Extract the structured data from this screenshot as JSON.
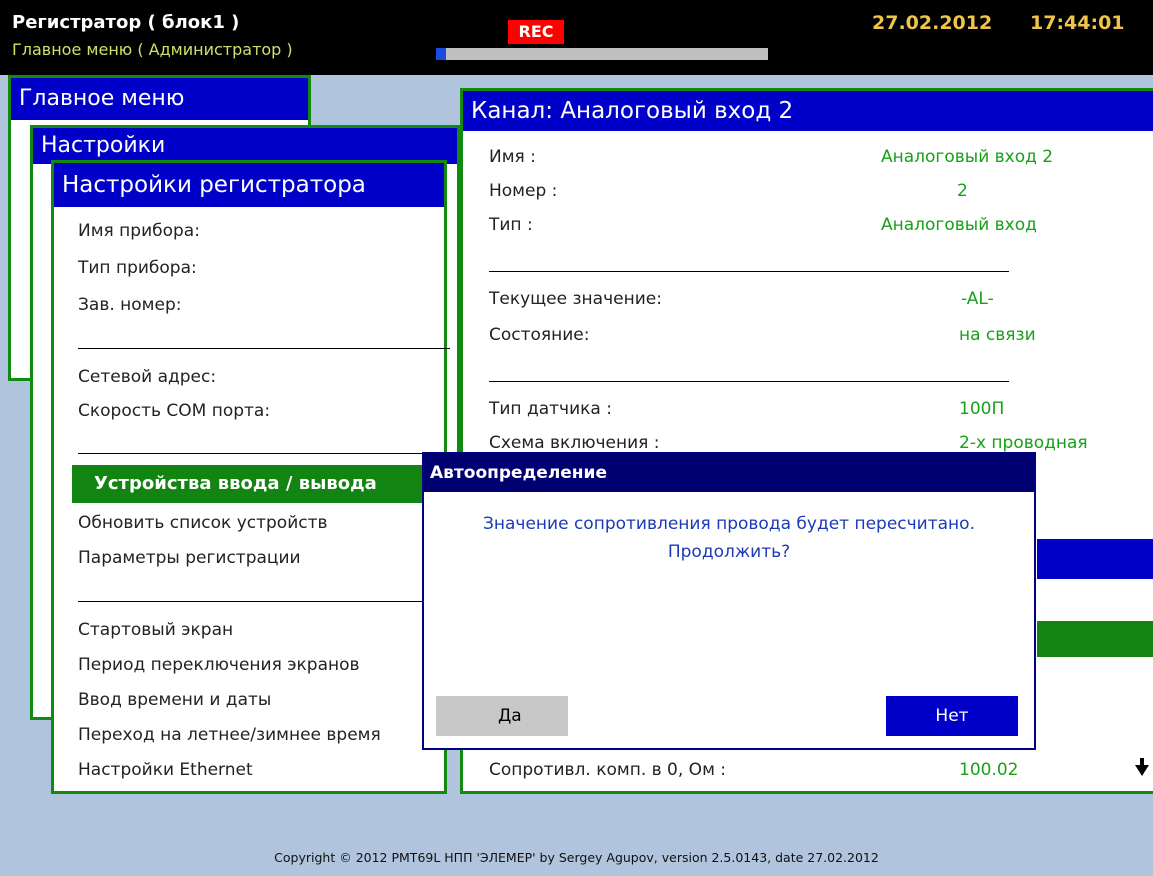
{
  "topbar": {
    "title": "Регистратор ( блок1 )",
    "subtitle": "Главное меню ( Администратор )",
    "rec_label": "REC",
    "date": "27.02.2012",
    "time": "17:44:01",
    "progress_fraction": 0.03
  },
  "panels": {
    "main_menu_title": "Главное меню",
    "settings_title": "Настройки",
    "recorder_settings": {
      "title": "Настройки регистратора",
      "items": [
        "Имя прибора:",
        "Тип прибора:",
        "Зав. номер:",
        "Сетевой адрес:",
        "Скорость COM порта:",
        "Устройства ввода / вывода",
        "Обновить список устройств",
        "Параметры регистрации",
        "Стартовый экран",
        "Период переключения экранов",
        "Ввод времени и даты",
        "Переход на летнее/зимнее время",
        "Настройки Ethernet"
      ]
    },
    "channel": {
      "title": "Канал: Аналоговый вход 2",
      "rows": [
        {
          "label": "Имя :",
          "value": "Аналоговый вход 2"
        },
        {
          "label": "Номер :",
          "value": "2"
        },
        {
          "label": "Тип :",
          "value": "Аналоговый вход"
        },
        {
          "label": "Текущее значение:",
          "value": "-AL-"
        },
        {
          "label": "Состояние:",
          "value": "на связи"
        },
        {
          "label": "Тип датчика :",
          "value": "100П"
        },
        {
          "label": "Схема включения :",
          "value": "2-х проводная"
        },
        {
          "label": "Сопротивл. комп. в 0, Ом :",
          "value": "100.02"
        }
      ]
    }
  },
  "dialog": {
    "title": "Автоопределение",
    "message_line1": "Значение сопротивления провода будет пересчитано.",
    "message_line2": "Продолжить?",
    "yes_label": "Да",
    "no_label": "Нет"
  },
  "footer": {
    "copyright": "Copyright © 2012 PMT69L НПП 'ЭЛЕМЕР' by Sergey Agupov, version 2.5.0143, date 27.02.2012"
  },
  "colors": {
    "header_blue": "#0000c8",
    "panel_border_green": "#128a12",
    "value_green": "#19a019",
    "rec_red": "#ff0000",
    "workarea": "#b0c4de"
  }
}
